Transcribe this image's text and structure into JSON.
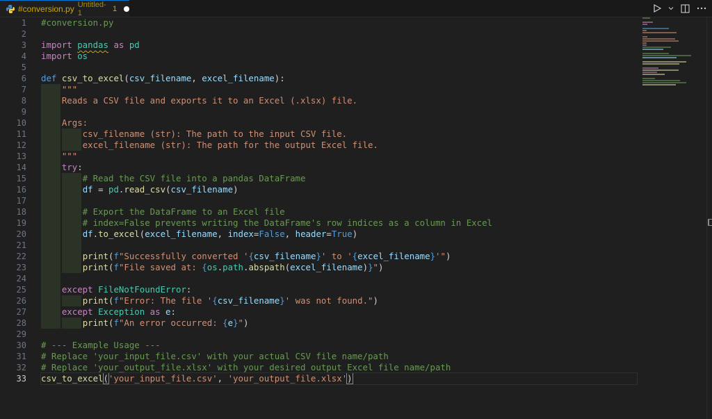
{
  "tab": {
    "filename": "#conversion.py",
    "subtitle": "Untitled-1",
    "problems": "1"
  },
  "colors": {
    "accent": "#0078d4",
    "warning": "#cca700",
    "keyword": "#569cd6",
    "control": "#c586c0",
    "function": "#dcdcaa",
    "variable": "#9cdcfe",
    "string": "#ce9178",
    "comment": "#6a9955",
    "class": "#4ec9b0"
  },
  "editor": {
    "active_line": 33,
    "lines": [
      [
        {
          "t": "#conversion.py",
          "c": "cmt"
        }
      ],
      [],
      [
        {
          "t": "import ",
          "c": "kw2"
        },
        {
          "t": "pandas",
          "c": "cls squig"
        },
        {
          "t": " as ",
          "c": "kw2"
        },
        {
          "t": "pd",
          "c": "cls"
        }
      ],
      [
        {
          "t": "import ",
          "c": "kw2"
        },
        {
          "t": "os",
          "c": "cls"
        }
      ],
      [],
      [
        {
          "t": "def ",
          "c": "kw"
        },
        {
          "t": "csv_to_excel",
          "c": "fn"
        },
        {
          "t": "(",
          "c": "pln"
        },
        {
          "t": "csv_filename",
          "c": "var"
        },
        {
          "t": ", ",
          "c": "pln"
        },
        {
          "t": "excel_filename",
          "c": "var"
        },
        {
          "t": "):",
          "c": "pln"
        }
      ],
      [
        {
          "t": "    \"\"\"",
          "c": "str"
        }
      ],
      [
        {
          "t": "    Reads a CSV file and exports it to an Excel (.xlsx) file.",
          "c": "str"
        }
      ],
      [],
      [
        {
          "t": "    Args:",
          "c": "str"
        }
      ],
      [
        {
          "t": "        csv_filename (str): The path to the input CSV file.",
          "c": "str"
        }
      ],
      [
        {
          "t": "        excel_filename (str): The path for the output Excel file.",
          "c": "str"
        }
      ],
      [
        {
          "t": "    \"\"\"",
          "c": "str"
        }
      ],
      [
        {
          "t": "    ",
          "c": "pln"
        },
        {
          "t": "try",
          "c": "kw2"
        },
        {
          "t": ":",
          "c": "pln"
        }
      ],
      [
        {
          "t": "        # Read the CSV file into a pandas DataFrame",
          "c": "cmt"
        }
      ],
      [
        {
          "t": "        ",
          "c": "pln"
        },
        {
          "t": "df",
          "c": "var"
        },
        {
          "t": " = ",
          "c": "pln"
        },
        {
          "t": "pd",
          "c": "cls"
        },
        {
          "t": ".",
          "c": "pln"
        },
        {
          "t": "read_csv",
          "c": "fn"
        },
        {
          "t": "(",
          "c": "pln"
        },
        {
          "t": "csv_filename",
          "c": "var"
        },
        {
          "t": ")",
          "c": "pln"
        }
      ],
      [],
      [
        {
          "t": "        # Export the DataFrame to an Excel file",
          "c": "cmt"
        }
      ],
      [
        {
          "t": "        # index=False prevents writing the DataFrame's row indices as a column in Excel",
          "c": "cmt"
        }
      ],
      [
        {
          "t": "        ",
          "c": "pln"
        },
        {
          "t": "df",
          "c": "var"
        },
        {
          "t": ".",
          "c": "pln"
        },
        {
          "t": "to_excel",
          "c": "fn"
        },
        {
          "t": "(",
          "c": "pln"
        },
        {
          "t": "excel_filename",
          "c": "var"
        },
        {
          "t": ", ",
          "c": "pln"
        },
        {
          "t": "index",
          "c": "var"
        },
        {
          "t": "=",
          "c": "pln"
        },
        {
          "t": "False",
          "c": "kw"
        },
        {
          "t": ", ",
          "c": "pln"
        },
        {
          "t": "header",
          "c": "var"
        },
        {
          "t": "=",
          "c": "pln"
        },
        {
          "t": "True",
          "c": "kw"
        },
        {
          "t": ")",
          "c": "pln"
        }
      ],
      [],
      [
        {
          "t": "        ",
          "c": "pln"
        },
        {
          "t": "print",
          "c": "fn"
        },
        {
          "t": "(",
          "c": "pln"
        },
        {
          "t": "f",
          "c": "kw"
        },
        {
          "t": "\"Successfully converted '",
          "c": "str"
        },
        {
          "t": "{",
          "c": "brace"
        },
        {
          "t": "csv_filename",
          "c": "var"
        },
        {
          "t": "}",
          "c": "brace"
        },
        {
          "t": "' to '",
          "c": "str"
        },
        {
          "t": "{",
          "c": "brace"
        },
        {
          "t": "excel_filename",
          "c": "var"
        },
        {
          "t": "}",
          "c": "brace"
        },
        {
          "t": "'\"",
          "c": "str"
        },
        {
          "t": ")",
          "c": "pln"
        }
      ],
      [
        {
          "t": "        ",
          "c": "pln"
        },
        {
          "t": "print",
          "c": "fn"
        },
        {
          "t": "(",
          "c": "pln"
        },
        {
          "t": "f",
          "c": "kw"
        },
        {
          "t": "\"File saved at: ",
          "c": "str"
        },
        {
          "t": "{",
          "c": "brace"
        },
        {
          "t": "os",
          "c": "cls"
        },
        {
          "t": ".",
          "c": "pln"
        },
        {
          "t": "path",
          "c": "cls"
        },
        {
          "t": ".",
          "c": "pln"
        },
        {
          "t": "abspath",
          "c": "fn"
        },
        {
          "t": "(",
          "c": "pln"
        },
        {
          "t": "excel_filename",
          "c": "var"
        },
        {
          "t": ")",
          "c": "pln"
        },
        {
          "t": "}",
          "c": "brace"
        },
        {
          "t": "\"",
          "c": "str"
        },
        {
          "t": ")",
          "c": "pln"
        }
      ],
      [],
      [
        {
          "t": "    ",
          "c": "pln"
        },
        {
          "t": "except ",
          "c": "kw2"
        },
        {
          "t": "FileNotFoundError",
          "c": "cls"
        },
        {
          "t": ":",
          "c": "pln"
        }
      ],
      [
        {
          "t": "        ",
          "c": "pln"
        },
        {
          "t": "print",
          "c": "fn"
        },
        {
          "t": "(",
          "c": "pln"
        },
        {
          "t": "f",
          "c": "kw"
        },
        {
          "t": "\"Error: The file '",
          "c": "str"
        },
        {
          "t": "{",
          "c": "brace"
        },
        {
          "t": "csv_filename",
          "c": "var"
        },
        {
          "t": "}",
          "c": "brace"
        },
        {
          "t": "' was not found.\"",
          "c": "str"
        },
        {
          "t": ")",
          "c": "pln"
        }
      ],
      [
        {
          "t": "    ",
          "c": "pln"
        },
        {
          "t": "except ",
          "c": "kw2"
        },
        {
          "t": "Exception",
          "c": "cls"
        },
        {
          "t": " as ",
          "c": "kw2"
        },
        {
          "t": "e",
          "c": "var"
        },
        {
          "t": ":",
          "c": "pln"
        }
      ],
      [
        {
          "t": "        ",
          "c": "pln"
        },
        {
          "t": "print",
          "c": "fn"
        },
        {
          "t": "(",
          "c": "pln"
        },
        {
          "t": "f",
          "c": "kw"
        },
        {
          "t": "\"An error occurred: ",
          "c": "str"
        },
        {
          "t": "{",
          "c": "brace"
        },
        {
          "t": "e",
          "c": "var"
        },
        {
          "t": "}",
          "c": "brace"
        },
        {
          "t": "\"",
          "c": "str"
        },
        {
          "t": ")",
          "c": "pln"
        }
      ],
      [],
      [
        {
          "t": "# --- Example Usage ---",
          "c": "cmt"
        }
      ],
      [
        {
          "t": "# Replace 'your_input_file.csv' with your actual CSV file name/path",
          "c": "cmt"
        }
      ],
      [
        {
          "t": "# Replace 'your_output_file.xlsx' with your desired output Excel file name/path",
          "c": "cmt"
        }
      ],
      [
        {
          "t": "csv_to_excel",
          "c": "fn"
        },
        {
          "t": "(",
          "c": "pln br-match"
        },
        {
          "t": "'your_input_file.csv'",
          "c": "str"
        },
        {
          "t": ", ",
          "c": "pln"
        },
        {
          "t": "'your_output_file.xlsx'",
          "c": "str"
        },
        {
          "t": ")",
          "c": "pln br-match"
        }
      ]
    ]
  }
}
